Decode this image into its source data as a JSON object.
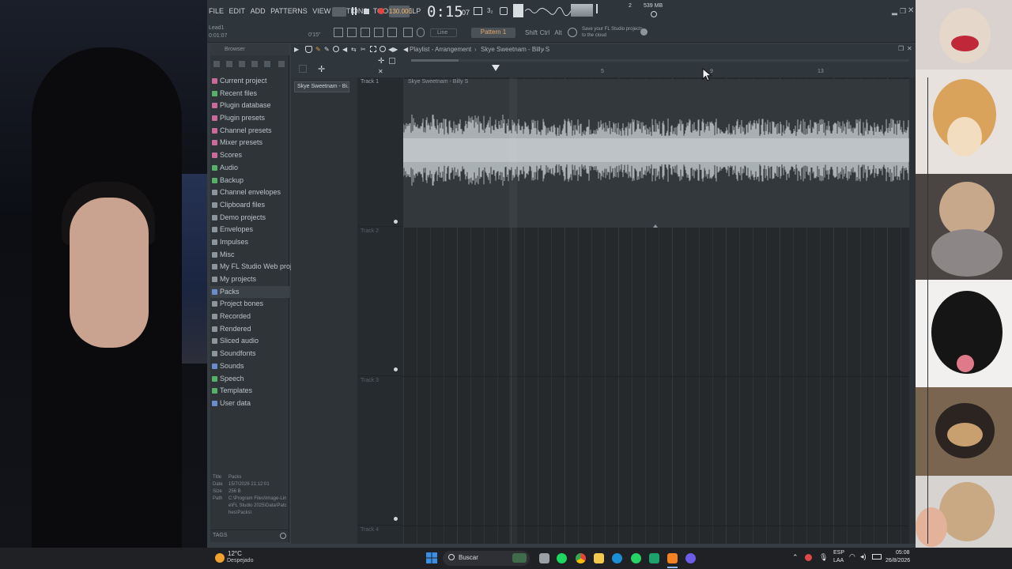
{
  "menu": [
    "FILE",
    "EDIT",
    "ADD",
    "PATTERNS",
    "VIEW",
    "OPTIONS",
    "TOOLS",
    "HELP"
  ],
  "transport": {
    "tempo": "130.000",
    "time": "0:15",
    "time_small": "07",
    "cpu": "539 MB",
    "cpu2": "2"
  },
  "toolbar": {
    "pattern_label": "Pattern 1",
    "line_label": "Line",
    "shift_label": "Shift",
    "ctrl_label": "Ctrl",
    "alt_label": "Alt",
    "hint": "Save your FL Studio projects to the cloud",
    "hint_small": "Save your FL Studio projects to the cloud"
  },
  "topleft": {
    "line1": "Lead1",
    "line2": "0:01:07",
    "counter": "0'15\""
  },
  "browser": {
    "header": "Browser",
    "items": [
      {
        "label": "Current project",
        "color": "#c86b9a"
      },
      {
        "label": "Recent files",
        "color": "#56b06a"
      },
      {
        "label": "Plugin database",
        "color": "#c86b9a"
      },
      {
        "label": "Plugin presets",
        "color": "#c86b9a"
      },
      {
        "label": "Channel presets",
        "color": "#c86b9a"
      },
      {
        "label": "Mixer presets",
        "color": "#c86b9a"
      },
      {
        "label": "Scores",
        "color": "#c86b9a"
      },
      {
        "label": "Audio",
        "color": "#56b06a"
      },
      {
        "label": "Backup",
        "color": "#56b06a"
      },
      {
        "label": "Channel envelopes",
        "color": "#8a959c"
      },
      {
        "label": "Clipboard files",
        "color": "#8a959c"
      },
      {
        "label": "Demo projects",
        "color": "#8a959c"
      },
      {
        "label": "Envelopes",
        "color": "#8a959c"
      },
      {
        "label": "Impulses",
        "color": "#8a959c"
      },
      {
        "label": "Misc",
        "color": "#8a959c"
      },
      {
        "label": "My FL Studio Web projects",
        "color": "#8a959c"
      },
      {
        "label": "My projects",
        "color": "#8a959c"
      },
      {
        "label": "Packs",
        "color": "#6b8cc8"
      },
      {
        "label": "Project bones",
        "color": "#8a959c"
      },
      {
        "label": "Recorded",
        "color": "#8a959c"
      },
      {
        "label": "Rendered",
        "color": "#8a959c"
      },
      {
        "label": "Sliced audio",
        "color": "#8a959c"
      },
      {
        "label": "Soundfonts",
        "color": "#8a959c"
      },
      {
        "label": "Sounds",
        "color": "#6b8cc8"
      },
      {
        "label": "Speech",
        "color": "#56b06a"
      },
      {
        "label": "Templates",
        "color": "#56b06a"
      },
      {
        "label": "User data",
        "color": "#6b8cc8"
      }
    ],
    "info": {
      "title_k": "Title",
      "title_v": "Packs",
      "date_k": "Date",
      "date_v": "15/7/2026 21:12:01",
      "size_k": "Size",
      "size_v": "256 B",
      "path_k": "Path",
      "path_v": "C:\\Program Files\\Image-Line\\FL Studio 2025\\Data\\Patches\\Packs\\"
    },
    "tags_label": "TAGS"
  },
  "playlist": {
    "title": "Playlist - Arrangement",
    "song": "Skye Sweetnam - Billy S",
    "pattern_item": "Skye Sweetnam - Bi...",
    "tracks": [
      "Track 1",
      "Track 2",
      "Track 3",
      "Track 4"
    ],
    "clip_label": "Skye Sweetnam - Billy S",
    "ruler": [
      "5",
      "9",
      "13"
    ]
  },
  "taskbar": {
    "weather_temp": "12°C",
    "weather_desc": "Despejado",
    "search": "Buscar",
    "lang1": "ESP",
    "lang2": "LAA",
    "clock_time": "05:08",
    "clock_date": "26/8/2026"
  }
}
